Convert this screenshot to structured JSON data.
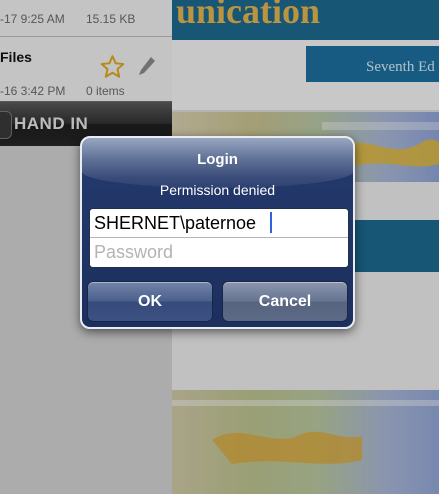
{
  "file_list": {
    "rows": [
      {
        "date": "-17 9:25 AM",
        "size": "15.15 KB"
      },
      {
        "name": "Files",
        "date": "-16 3:42 PM",
        "size": "0 items"
      }
    ],
    "hand_in_label": "HAND IN"
  },
  "document": {
    "title_fragment": "unication",
    "edition_fragment": "Seventh Ed"
  },
  "login": {
    "title": "Login",
    "message": "Permission denied",
    "username_value": "SHERNET\\paternoe",
    "password_placeholder": "Password",
    "ok_label": "OK",
    "cancel_label": "Cancel"
  },
  "colors": {
    "dialog_bg": "#1c2f5e",
    "document_blue": "#1d6a8f",
    "title_gold": "#e3b54f",
    "caret_blue": "#2b63e0"
  }
}
